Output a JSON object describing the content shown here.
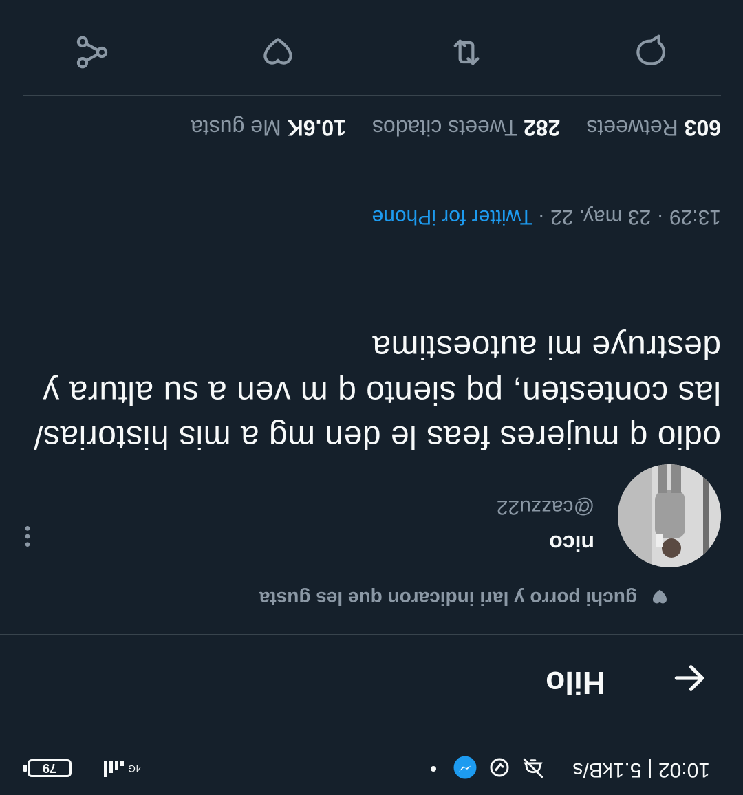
{
  "status_bar": {
    "time": "10:02 | 5.1kB/s",
    "network_label": "4G",
    "battery": "79"
  },
  "header": {
    "title": "Hilo"
  },
  "tweet": {
    "social_context": "guchi porro y lari indicaron que les gusta",
    "author_name": "nico",
    "author_handle": "@cazzu22",
    "text": "odio q mujeres feas le den mg a mis historias/ las contesten, pq siento q m ven a su altura y destruye mi autoestima",
    "time": "13:29 · 23 may. 22 · ",
    "source": "Twitter for iPhone"
  },
  "stats": {
    "retweets_count": "603",
    "retweets_label": "Retweets",
    "quotes_count": "282",
    "quotes_label": "Tweets citados",
    "likes_count": "10.6K",
    "likes_label": "Me gusta"
  },
  "colors": {
    "background": "#15202b",
    "text": "#f7f9f9",
    "secondary": "#8b98a5",
    "accent": "#1d9bf0",
    "divider": "#38444d"
  },
  "icons": [
    "back-arrow-icon",
    "heart-icon",
    "more-icon",
    "reply-icon",
    "retweet-icon",
    "like-icon",
    "share-icon",
    "messenger-icon",
    "alarm-off-icon",
    "sync-icon",
    "signal-icon",
    "battery-icon"
  ]
}
